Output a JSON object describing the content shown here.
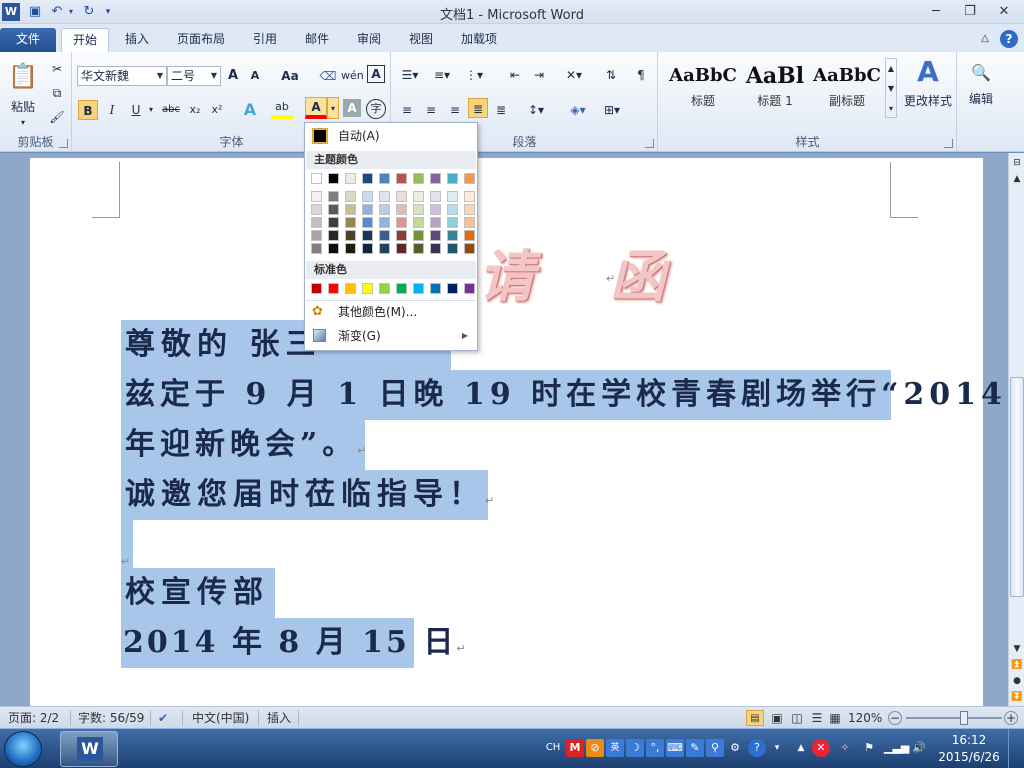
{
  "window": {
    "title": "文档1 - Microsoft Word",
    "min_icon": "minimize-icon",
    "max_icon": "restore-icon",
    "close_icon": "close-icon"
  },
  "tabs": [
    {
      "label": "文件"
    },
    {
      "label": "开始"
    },
    {
      "label": "插入"
    },
    {
      "label": "页面布局"
    },
    {
      "label": "引用"
    },
    {
      "label": "邮件"
    },
    {
      "label": "审阅"
    },
    {
      "label": "视图"
    },
    {
      "label": "加载项"
    }
  ],
  "ribbon": {
    "clipboard": {
      "label": "剪贴板",
      "paste": "粘贴"
    },
    "font": {
      "label": "字体",
      "font_name": "华文新魏",
      "font_size": "二号",
      "grow": "A",
      "shrink": "A",
      "aa": "Aa",
      "bold": "B",
      "italic": "I",
      "underline": "U",
      "strike": "abc",
      "sub": "x₂",
      "sup": "x²",
      "font_color": "A",
      "char_shade": "A",
      "enclose": "字"
    },
    "paragraph": {
      "label": "段落"
    },
    "styles": {
      "label": "样式",
      "items": [
        {
          "sample": "AaBbC",
          "name": "标题"
        },
        {
          "sample": "AaBl",
          "name": "标题 1"
        },
        {
          "sample": "AaBbC",
          "name": "副标题"
        }
      ],
      "change": "更改样式"
    },
    "editing": {
      "label": "编辑"
    }
  },
  "color_menu": {
    "auto": "自动(A)",
    "theme_header": "主题颜色",
    "theme_top": [
      "#ffffff",
      "#000000",
      "#eeece1",
      "#1f497d",
      "#4f81bd",
      "#c0504d",
      "#9bbb59",
      "#8064a2",
      "#4bacc6",
      "#f79646"
    ],
    "theme_shades": [
      [
        "#f2f2f2",
        "#7f7f7f",
        "#ddd9c3",
        "#c6d9f0",
        "#dbe5f1",
        "#f2dcdb",
        "#ebf1dd",
        "#e5e0ec",
        "#dbeef3",
        "#fdeada"
      ],
      [
        "#d8d8d8",
        "#595959",
        "#c4bd97",
        "#8db3e2",
        "#b8cce4",
        "#e5b9b7",
        "#d7e3bc",
        "#ccc1d9",
        "#b7dde8",
        "#fbd5b5"
      ],
      [
        "#bfbfbf",
        "#3f3f3f",
        "#938953",
        "#548dd4",
        "#95b3d7",
        "#d99694",
        "#c3d69b",
        "#b2a2c7",
        "#92cddc",
        "#fac08f"
      ],
      [
        "#a5a5a5",
        "#262626",
        "#494429",
        "#17365d",
        "#366092",
        "#953734",
        "#76923c",
        "#5f497a",
        "#31859b",
        "#e36c09"
      ],
      [
        "#7f7f7f",
        "#0c0c0c",
        "#1d1b10",
        "#0f243e",
        "#244061",
        "#632423",
        "#4f6128",
        "#3f3151",
        "#205867",
        "#974806"
      ]
    ],
    "standard_header": "标准色",
    "standard": [
      "#c00000",
      "#ff0000",
      "#ffc000",
      "#ffff00",
      "#92d050",
      "#00b050",
      "#00b0f0",
      "#0070c0",
      "#002060",
      "#7030a0"
    ],
    "more": "其他颜色(M)...",
    "gradient": "渐变(G)"
  },
  "document": {
    "title_visible": "请 函",
    "lines": [
      "尊敬的 张三",
      "兹定于 9 月 1 日晚 19 时在学校青春剧场举行“2014",
      "年迎新晚会”。",
      "诚邀您届时莅临指导！",
      "",
      "校宣传部",
      "2014 年 8 月 15 日"
    ],
    "para_mark": "↵"
  },
  "status": {
    "page": "页面: 2/2",
    "words": "字数: 56/59",
    "lang": "中文(中国)",
    "mode": "插入",
    "zoom": "120%",
    "zoom_level": 0.6
  },
  "taskbar": {
    "lang": "CH",
    "time": "16:12",
    "date": "2015/6/26"
  }
}
